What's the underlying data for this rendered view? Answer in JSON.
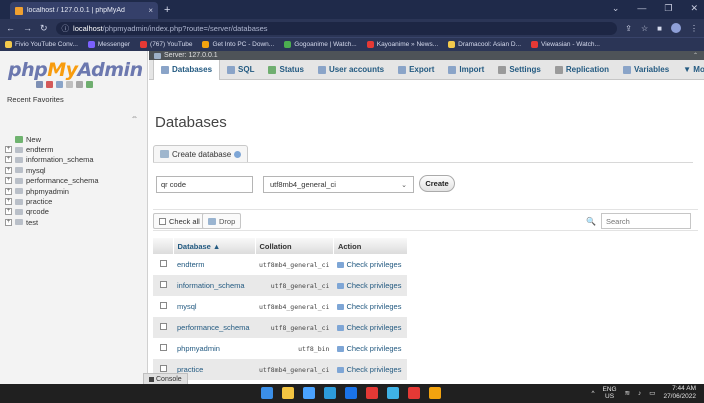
{
  "browser": {
    "tab_title": "localhost / 127.0.0.1 | phpMyAd",
    "tab_close": "×",
    "new_tab": "+",
    "url_host": "localhost",
    "url_path": "/phpmyadmin/index.php?route=/server/databases",
    "bookmarks": [
      {
        "label": "Fivio YouTube Conv...",
        "color": "#f2c94c"
      },
      {
        "label": "Messenger",
        "color": "#7b61ff"
      },
      {
        "label": "(767) YouTube",
        "color": "#e53935"
      },
      {
        "label": "Get Into PC - Down...",
        "color": "#f2a30f"
      },
      {
        "label": "Gogoanime | Watch...",
        "color": "#4caf50"
      },
      {
        "label": "Kayoanime » News...",
        "color": "#e53935"
      },
      {
        "label": "Dramacool: Asian D...",
        "color": "#f2c94c"
      },
      {
        "label": "Viewasian - Watch...",
        "color": "#e53935"
      }
    ]
  },
  "sidebar": {
    "logo_php": "php",
    "logo_my": "My",
    "logo_admin": "Admin",
    "recent_favorites": "Recent  Favorites",
    "tree": [
      {
        "label": "New",
        "kind": "new"
      },
      {
        "label": "endterm",
        "kind": "db"
      },
      {
        "label": "information_schema",
        "kind": "db"
      },
      {
        "label": "mysql",
        "kind": "db"
      },
      {
        "label": "performance_schema",
        "kind": "db"
      },
      {
        "label": "phpmyadmin",
        "kind": "db"
      },
      {
        "label": "practice",
        "kind": "db"
      },
      {
        "label": "qrcode",
        "kind": "db"
      },
      {
        "label": "test",
        "kind": "db"
      }
    ]
  },
  "server_bar": {
    "label": "Server: 127.0.0.1"
  },
  "menu": {
    "items": [
      {
        "label": "Databases",
        "color": "#8aa4c8",
        "active": true
      },
      {
        "label": "SQL",
        "color": "#8aa4c8"
      },
      {
        "label": "Status",
        "color": "#6fae6f"
      },
      {
        "label": "User accounts",
        "color": "#8aa4c8"
      },
      {
        "label": "Export",
        "color": "#8aa4c8"
      },
      {
        "label": "Import",
        "color": "#8aa4c8"
      },
      {
        "label": "Settings",
        "color": "#9a9a9a"
      },
      {
        "label": "Replication",
        "color": "#9a9a9a"
      },
      {
        "label": "Variables",
        "color": "#8aa4c8"
      }
    ],
    "more": "▼ More"
  },
  "main": {
    "heading": "Databases",
    "create_legend": "Create database",
    "db_name_value": "qr code",
    "collation_value": "utf8mb4_general_ci",
    "create_button": "Create",
    "check_all": "Check all",
    "drop_button": "Drop",
    "search_placeholder": "Search",
    "table": {
      "headers": [
        "Database ▲",
        "Collation",
        "Action"
      ],
      "rows": [
        {
          "name": "endterm",
          "collation": "utf8mb4_general_ci",
          "action": "Check privileges"
        },
        {
          "name": "information_schema",
          "collation": "utf8_general_ci",
          "action": "Check privileges"
        },
        {
          "name": "mysql",
          "collation": "utf8mb4_general_ci",
          "action": "Check privileges"
        },
        {
          "name": "performance_schema",
          "collation": "utf8_general_ci",
          "action": "Check privileges"
        },
        {
          "name": "phpmyadmin",
          "collation": "utf8_bin",
          "action": "Check privileges"
        },
        {
          "name": "practice",
          "collation": "utf8mb4_general_ci",
          "action": "Check privileges"
        }
      ]
    }
  },
  "console": {
    "label": "Console"
  },
  "taskbar": {
    "apps": [
      "#3b8fe8",
      "#f4c542",
      "#4aa3ff",
      "#2d9cdb",
      "#1a73e8",
      "#e53935",
      "#3fb2e6",
      "#e53935",
      "#f2a30f"
    ],
    "lang_top": "ENG",
    "lang_bottom": "US",
    "time": "7:44 AM",
    "date": "27/06/2022"
  }
}
